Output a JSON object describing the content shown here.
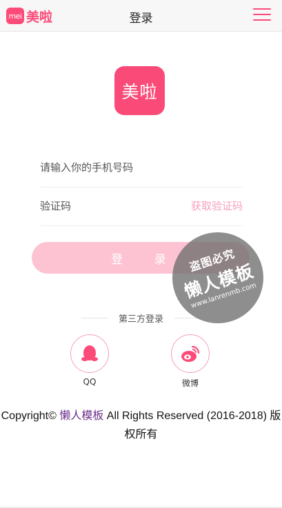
{
  "header": {
    "brand_badge": "mei",
    "brand_name": "美啦",
    "title": "登录",
    "menu_icon": "hamburger-menu-icon"
  },
  "logo": {
    "text": "美啦"
  },
  "form": {
    "phone_placeholder": "请输入你的手机号码",
    "code_placeholder": "验证码",
    "get_code_label": "获取验证码",
    "login_label": "登 录"
  },
  "third_party": {
    "heading": "第三方登录",
    "qq_label": "QQ",
    "weibo_label": "微博"
  },
  "footer": {
    "prefix": "Copyright© ",
    "link_text": "懒人模板",
    "suffix": " All Rights Reserved (2016-2018) 版权所有"
  },
  "watermark": {
    "top": "盗图必究",
    "main": "懒人模板",
    "url": "www.lanrenmb.com"
  },
  "colors": {
    "brand": "#fc4b79",
    "button": "#fdc3d3",
    "accent_text": "#f7a0bb"
  }
}
